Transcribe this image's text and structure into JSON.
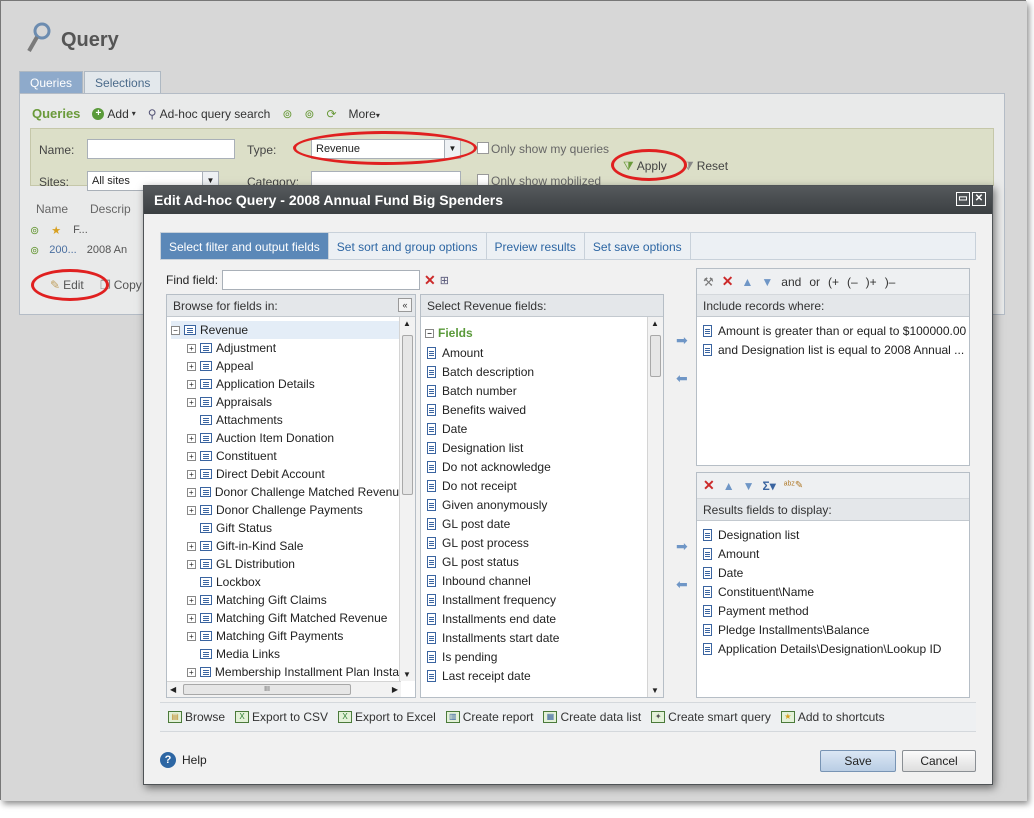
{
  "background": {
    "title": "Query",
    "tabs": [
      "Queries",
      "Selections"
    ],
    "panel_title": "Queries",
    "toolbar": [
      "Add",
      "Ad-hoc query search",
      "More"
    ],
    "filters": {
      "name_label": "Name:",
      "type_label": "Type:",
      "type_value": "Revenue",
      "only_mine": "Only show my queries",
      "sites_label": "Sites:",
      "sites_value": "All sites",
      "category_label": "Category:",
      "only_mobilized": "Only show mobilized",
      "apply": "Apply",
      "reset": "Reset"
    },
    "grid": {
      "col_name": "Name",
      "col_desc": "Descrip",
      "row1": "F...",
      "row2_a": "200...",
      "row2_b": "2008 An"
    },
    "edit": "Edit",
    "copy": "Copy"
  },
  "modal": {
    "title": "Edit Ad-hoc Query - 2008 Annual Fund Big Spenders",
    "tabs": [
      "Select filter and output fields",
      "Set sort and group options",
      "Preview results",
      "Set save options"
    ],
    "find_label": "Find field:",
    "browse_header": "Browse for fields in:",
    "tree_root": "Revenue",
    "tree": [
      {
        "label": "Adjustment",
        "expand": true
      },
      {
        "label": "Appeal",
        "expand": true
      },
      {
        "label": "Application Details",
        "expand": true
      },
      {
        "label": "Appraisals",
        "expand": true
      },
      {
        "label": "Attachments",
        "expand": false
      },
      {
        "label": "Auction Item Donation",
        "expand": true
      },
      {
        "label": "Constituent",
        "expand": true
      },
      {
        "label": "Direct Debit Account",
        "expand": true
      },
      {
        "label": "Donor Challenge Matched Revenu",
        "expand": true
      },
      {
        "label": "Donor Challenge Payments",
        "expand": true
      },
      {
        "label": "Gift Status",
        "expand": false
      },
      {
        "label": "Gift-in-Kind Sale",
        "expand": true
      },
      {
        "label": "GL Distribution",
        "expand": true
      },
      {
        "label": "Lockbox",
        "expand": false
      },
      {
        "label": "Matching Gift Claims",
        "expand": true
      },
      {
        "label": "Matching Gift Matched Revenue",
        "expand": true
      },
      {
        "label": "Matching Gift Payments",
        "expand": true
      },
      {
        "label": "Media Links",
        "expand": false
      },
      {
        "label": "Membership Installment Plan Insta",
        "expand": true
      }
    ],
    "hscroll_label": "III",
    "fields_header": "Select Revenue fields:",
    "fields_group": "Fields",
    "fields": [
      "Amount",
      "Batch description",
      "Batch number",
      "Benefits waived",
      "Date",
      "Designation list",
      "Do not acknowledge",
      "Do not receipt",
      "Given anonymously",
      "GL post date",
      "GL post process",
      "GL post status",
      "Inbound channel",
      "Installment frequency",
      "Installments end date",
      "Installments start date",
      "Is pending",
      "Last receipt date"
    ],
    "filter_toolbar": [
      "and",
      "or",
      "(+",
      "(–",
      ")+",
      ")–"
    ],
    "include_header": "Include records where:",
    "include_rows": [
      "Amount is greater than or equal to $100000.00",
      "and Designation list is equal to 2008 Annual ..."
    ],
    "results_header": "Results fields to display:",
    "results_rows": [
      "Designation list",
      "Amount",
      "Date",
      "Constituent\\Name",
      "Payment method",
      "Pledge Installments\\Balance",
      "Application Details\\Designation\\Lookup ID"
    ],
    "footer_actions": [
      "Browse",
      "Export to CSV",
      "Export to Excel",
      "Create report",
      "Create data list",
      "Create smart query",
      "Add to shortcuts"
    ],
    "help": "Help",
    "save": "Save",
    "cancel": "Cancel"
  }
}
